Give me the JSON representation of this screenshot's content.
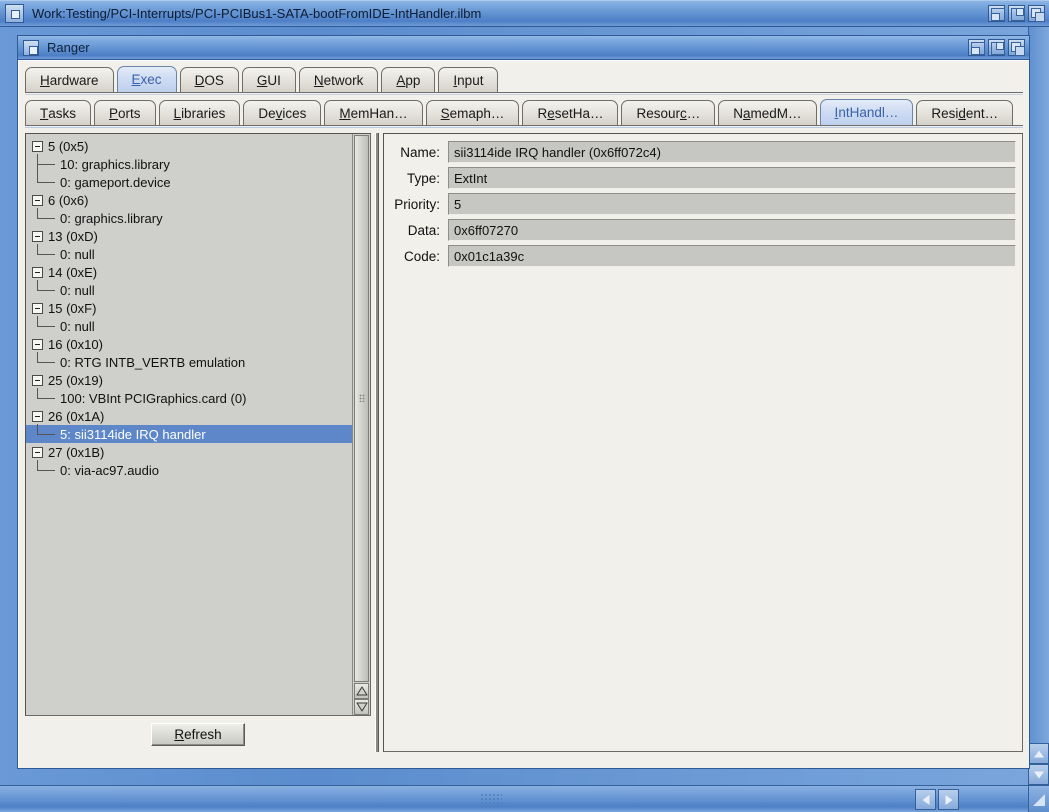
{
  "outer_window": {
    "title": "Work:Testing/PCI-Interrupts/PCI-PCIBus1-SATA-bootFromIDE-IntHandler.ilbm",
    "close_icon": "close-icon",
    "gadgets": [
      "depth-gadget",
      "zoom-gadget",
      "front-gadget"
    ]
  },
  "inner_window": {
    "title": "Ranger",
    "close_icon": "close-icon",
    "gadgets": [
      "depth-gadget",
      "zoom-gadget",
      "front-gadget"
    ]
  },
  "tabs_primary": [
    {
      "label": "Hardware",
      "mnemonic": "H",
      "active": false
    },
    {
      "label": "Exec",
      "mnemonic": "E",
      "active": true
    },
    {
      "label": "DOS",
      "mnemonic": "D",
      "active": false
    },
    {
      "label": "GUI",
      "mnemonic": "G",
      "active": false
    },
    {
      "label": "Network",
      "mnemonic": "N",
      "active": false
    },
    {
      "label": "App",
      "mnemonic": "A",
      "active": false
    },
    {
      "label": "Input",
      "mnemonic": "I",
      "active": false
    }
  ],
  "tabs_secondary": [
    {
      "label": "Tasks",
      "mnemonic": "T",
      "active": false
    },
    {
      "label": "Ports",
      "mnemonic": "P",
      "active": false
    },
    {
      "label": "Libraries",
      "mnemonic": "L",
      "active": false
    },
    {
      "label": "Devices",
      "mnemonic": "v",
      "active": false
    },
    {
      "label": "MemHan…",
      "mnemonic": "M",
      "active": false
    },
    {
      "label": "Semaph…",
      "mnemonic": "S",
      "active": false
    },
    {
      "label": "ResetHa…",
      "mnemonic": "e",
      "active": false
    },
    {
      "label": "Resourc…",
      "mnemonic": "c",
      "active": false
    },
    {
      "label": "NamedM…",
      "mnemonic": "a",
      "active": false
    },
    {
      "label": "IntHandl…",
      "mnemonic": "I",
      "active": true
    },
    {
      "label": "Resident…",
      "mnemonic": "d",
      "active": false
    }
  ],
  "tree": [
    {
      "level": 0,
      "label": "5 (0x5)",
      "expanded": true,
      "selected": false,
      "connector": "none"
    },
    {
      "level": 1,
      "label": "10: graphics.library",
      "selected": false,
      "connector": "mid"
    },
    {
      "level": 1,
      "label": "0: gameport.device",
      "selected": false,
      "connector": "last"
    },
    {
      "level": 0,
      "label": "6 (0x6)",
      "expanded": true,
      "selected": false,
      "connector": "none"
    },
    {
      "level": 1,
      "label": "0: graphics.library",
      "selected": false,
      "connector": "last"
    },
    {
      "level": 0,
      "label": "13 (0xD)",
      "expanded": true,
      "selected": false,
      "connector": "none"
    },
    {
      "level": 1,
      "label": "0: null",
      "selected": false,
      "connector": "last"
    },
    {
      "level": 0,
      "label": "14 (0xE)",
      "expanded": true,
      "selected": false,
      "connector": "none"
    },
    {
      "level": 1,
      "label": "0: null",
      "selected": false,
      "connector": "last"
    },
    {
      "level": 0,
      "label": "15 (0xF)",
      "expanded": true,
      "selected": false,
      "connector": "none"
    },
    {
      "level": 1,
      "label": "0: null",
      "selected": false,
      "connector": "last"
    },
    {
      "level": 0,
      "label": "16 (0x10)",
      "expanded": true,
      "selected": false,
      "connector": "none"
    },
    {
      "level": 1,
      "label": "0: RTG INTB_VERTB emulation",
      "selected": false,
      "connector": "last"
    },
    {
      "level": 0,
      "label": "25 (0x19)",
      "expanded": true,
      "selected": false,
      "connector": "none"
    },
    {
      "level": 1,
      "label": "100: VBInt PCIGraphics.card (0)",
      "selected": false,
      "connector": "last"
    },
    {
      "level": 0,
      "label": "26 (0x1A)",
      "expanded": true,
      "selected": false,
      "connector": "none"
    },
    {
      "level": 1,
      "label": "5: sii3114ide IRQ handler",
      "selected": true,
      "connector": "last"
    },
    {
      "level": 0,
      "label": "27 (0x1B)",
      "expanded": true,
      "selected": false,
      "connector": "none"
    },
    {
      "level": 1,
      "label": "0: via-ac97.audio",
      "selected": false,
      "connector": "last"
    }
  ],
  "details": [
    {
      "label": "Name:",
      "value": "sii3114ide IRQ handler (0x6ff072c4)"
    },
    {
      "label": "Type:",
      "value": "ExtInt"
    },
    {
      "label": "Priority:",
      "value": "5"
    },
    {
      "label": "Data:",
      "value": "0x6ff07270"
    },
    {
      "label": "Code:",
      "value": "0x01c1a39c"
    }
  ],
  "buttons": {
    "refresh": {
      "label": "Refresh",
      "mnemonic": "R"
    }
  },
  "scrollbars": {
    "tree_up_icon": "arrow-up-icon",
    "tree_down_icon": "arrow-down-icon",
    "outer_up_icon": "arrow-up-icon",
    "outer_down_icon": "arrow-down-icon",
    "outer_left_icon": "arrow-left-icon",
    "outer_right_icon": "arrow-right-icon"
  },
  "colors": {
    "title_blue": "#5e8fd0",
    "selection_blue": "#5d87c8",
    "active_tab_text": "#3a63a8",
    "panel_gray": "#cfcfcb",
    "field_gray": "#c6c6c2"
  }
}
